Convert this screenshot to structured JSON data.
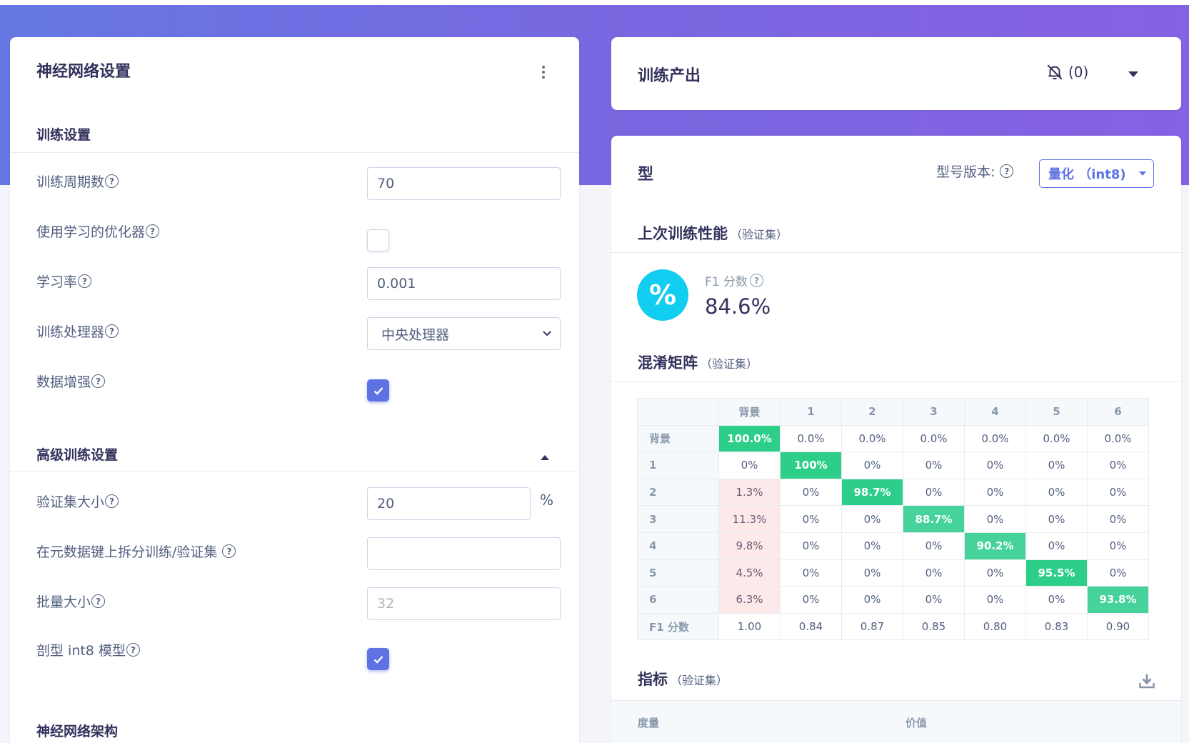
{
  "left": {
    "title": "神经网络设置",
    "training_section": "训练设置",
    "fields": {
      "epochs": {
        "label": "训练周期数",
        "value": "70"
      },
      "learned_optimizer": {
        "label": "使用学习的优化器",
        "checked": false
      },
      "learning_rate": {
        "label": "学习率",
        "value": "0.001"
      },
      "processor": {
        "label": "训练处理器",
        "value": "中央处理器"
      },
      "augmentation": {
        "label": "数据增强",
        "checked": true
      }
    },
    "advanced_section": "高级训练设置",
    "advanced": {
      "validation_size": {
        "label": "验证集大小",
        "value": "20",
        "suffix": "%"
      },
      "split_key": {
        "label": "在元数据键上拆分训练/验证集 ",
        "value": ""
      },
      "batch_size": {
        "label": "批量大小",
        "placeholder": "32"
      },
      "profile_int8": {
        "label": "剖型 int8 模型",
        "checked": true
      }
    },
    "architecture_section": "神经网络架构"
  },
  "output": {
    "title": "训练产出",
    "notification_count": "(0)"
  },
  "model": {
    "title": "型",
    "version_label": "型号版本:",
    "version_value": "量化 （int8)",
    "performance_title": "上次训练性能",
    "performance_note": "（验证集）",
    "metric_symbol": "%",
    "f1_label": "F1 分数",
    "f1_value": "84.6%",
    "matrix_title": "混淆矩阵",
    "matrix_note": "（验证集）",
    "metrics_title": "指标",
    "metrics_note": "（验证集）",
    "metrics_columns": [
      "度量",
      "价值"
    ]
  },
  "chart_data": {
    "type": "table",
    "columns": [
      "",
      "背景",
      "1",
      "2",
      "3",
      "4",
      "5",
      "6"
    ],
    "rows": [
      {
        "label": "背景",
        "cells": [
          "100.0%",
          "0.0%",
          "0.0%",
          "0.0%",
          "0.0%",
          "0.0%",
          "0.0%"
        ]
      },
      {
        "label": "1",
        "cells": [
          "0%",
          "100%",
          "0%",
          "0%",
          "0%",
          "0%",
          "0%"
        ]
      },
      {
        "label": "2",
        "cells": [
          "1.3%",
          "0%",
          "98.7%",
          "0%",
          "0%",
          "0%",
          "0%"
        ]
      },
      {
        "label": "3",
        "cells": [
          "11.3%",
          "0%",
          "0%",
          "88.7%",
          "0%",
          "0%",
          "0%"
        ]
      },
      {
        "label": "4",
        "cells": [
          "9.8%",
          "0%",
          "0%",
          "0%",
          "90.2%",
          "0%",
          "0%"
        ]
      },
      {
        "label": "5",
        "cells": [
          "4.5%",
          "0%",
          "0%",
          "0%",
          "0%",
          "95.5%",
          "0%"
        ]
      },
      {
        "label": "6",
        "cells": [
          "6.3%",
          "0%",
          "0%",
          "0%",
          "0%",
          "0%",
          "93.8%"
        ]
      }
    ],
    "f1_row": {
      "label": "F1 分数",
      "cells": [
        "1.00",
        "0.84",
        "0.87",
        "0.85",
        "0.80",
        "0.83",
        "0.90"
      ]
    },
    "colors": {
      "correct_high": "#2dce89",
      "correct_mid": "#45d39b",
      "misclassified": "#fde8ea"
    }
  }
}
